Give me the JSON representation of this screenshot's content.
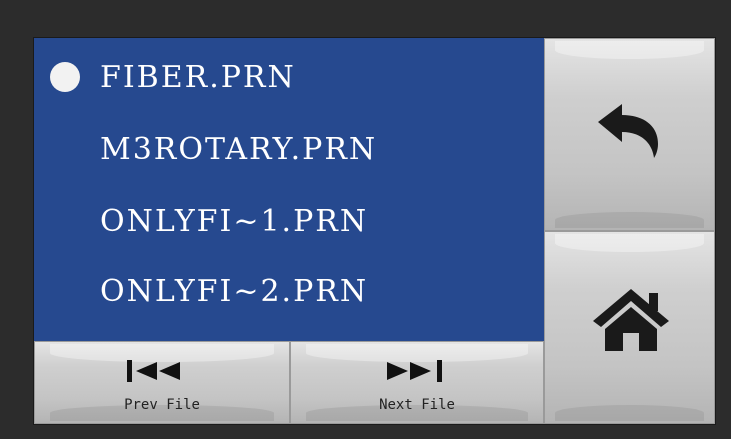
{
  "files": [
    {
      "name": "FIBER.PRN",
      "selected": true
    },
    {
      "name": "M3ROTARY.PRN",
      "selected": false
    },
    {
      "name": "ONLYFI~1.PRN",
      "selected": false
    },
    {
      "name": "ONLYFI~2.PRN",
      "selected": false
    }
  ],
  "buttons": {
    "prev_label": "Prev File",
    "next_label": "Next File",
    "back_icon": "back-arrow-icon",
    "home_icon": "home-icon"
  },
  "colors": {
    "panel": "#26498f",
    "button": "#c9c9c9",
    "text": "#ffffff"
  }
}
